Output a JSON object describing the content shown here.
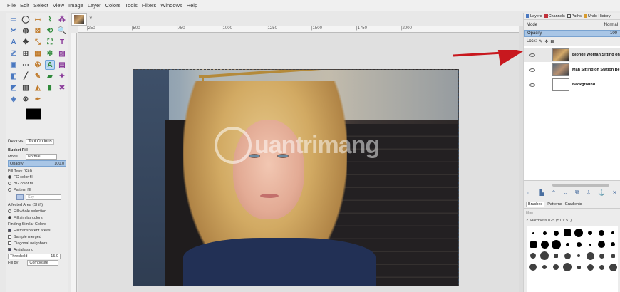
{
  "menu": [
    "File",
    "Edit",
    "Select",
    "View",
    "Image",
    "Layer",
    "Colors",
    "Tools",
    "Filters",
    "Windows",
    "Help"
  ],
  "image_tab": {
    "close_glyph": "×"
  },
  "ruler_ticks": [
    "|250",
    "|500",
    "|750",
    "|1000",
    "|1250",
    "|1500",
    "|1750",
    "|2000"
  ],
  "toolbox": {
    "tools": [
      "▭",
      "◯",
      "ꟷ",
      "⌇",
      "⁂",
      "✂",
      "◍",
      "⊠",
      "⟲",
      "🔍",
      "A",
      "✥",
      "⤡",
      "⛶",
      "T",
      "⎚",
      "⊞",
      "▦",
      "✲",
      "▨",
      "▣",
      "⋯",
      "✇",
      "A",
      "▤",
      "◧",
      "╱",
      "✎",
      "▰",
      "✦",
      "◩",
      "▥",
      "◭",
      "▮",
      "✖",
      "◈",
      "⊗",
      "✒",
      "",
      ""
    ],
    "selected_index": 23
  },
  "tool_options": {
    "tabs": [
      "Devices",
      "Tool Options"
    ],
    "title": "Bucket Fill",
    "mode_label": "Mode",
    "mode_value": "Normal",
    "opacity_label": "Opacity",
    "opacity_value": "100.0",
    "fill_type_label": "Fill Type  (Ctrl)",
    "fill_types": [
      {
        "label": "FG color fill",
        "on": true
      },
      {
        "label": "BG color fill",
        "on": false
      },
      {
        "label": "Pattern fill",
        "on": false
      }
    ],
    "pattern_name": "Sky",
    "affected_label": "Affected Area  (Shift)",
    "affected": [
      {
        "label": "Fill whole selection",
        "on": false
      },
      {
        "label": "Fill similar colors",
        "on": true
      }
    ],
    "similar_label": "Finding Similar Colors",
    "checks": [
      {
        "label": "Fill transparent areas",
        "on": true
      },
      {
        "label": "Sample merged",
        "on": false
      },
      {
        "label": "Diagonal neighbors",
        "on": false
      },
      {
        "label": "Antialiasing",
        "on": true
      }
    ],
    "threshold_label": "Threshold",
    "threshold_value": "15.0",
    "fill_by_label": "Fill by",
    "fill_by_value": "Composite"
  },
  "watermark": {
    "text": "uantrimang"
  },
  "dock": {
    "tabs": [
      "Layers",
      "Channels",
      "Paths",
      "Undo History"
    ],
    "mode_label": "Mode",
    "mode_value": "Normal",
    "opacity_label": "Opacity",
    "opacity_value": "100",
    "lock_label": "Lock:",
    "layers": [
      {
        "name": "Blonde Woman Sitting on",
        "active": true
      },
      {
        "name": "Man Sitting on Station Be",
        "active": false
      },
      {
        "name": "Background",
        "active": false
      }
    ],
    "layer_tool_glyphs": [
      "▭",
      "▙",
      "⌃",
      "⌄",
      "⧉",
      "⇩",
      "⚓",
      "✕"
    ],
    "brush_tabs": [
      "Brushes",
      "Patterns",
      "Gradients"
    ],
    "brush_filter": "filter",
    "brush_name": "2. Hardness 025 (51 × 51)"
  },
  "colors": {
    "accent": "#a9c6e6",
    "arrow": "#c8181e",
    "fg": "#000000",
    "bg": "#ffffff"
  }
}
